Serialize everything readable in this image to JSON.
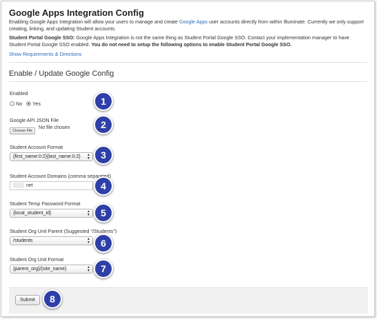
{
  "header": {
    "title": "Google Apps Integration Config",
    "intro_before_link": "Enabling Google Apps Integration will allow your users to manage and create ",
    "intro_link": "Google Apps",
    "intro_after_link": " user accounts directly from within Illuminate. Currently we only support creating, linking, and updating Student accounts.",
    "note_bold_lead": "Student Portal Google SSO:",
    "note_body": " Google Apps Integration is not the same thing as Student Portal Google SSO. Contact your implementation manager to have Student Portal Google SSO enabled. ",
    "note_bold_tail": "You do not need to setup the following options to enable Student Portal Google SSO.",
    "requirements_link": "Show Requirements & Directions"
  },
  "section": {
    "title": "Enable / Update Google Config"
  },
  "form": {
    "enabled": {
      "label": "Enabled",
      "option_no": "No",
      "option_yes": "Yes",
      "selected": "Yes"
    },
    "json_file": {
      "label": "Google API JSON File",
      "button": "Choose File",
      "status": "No file chosen"
    },
    "account_format": {
      "label": "Student Account Format",
      "value": "{first_name:0:2}{last_name:0:2}"
    },
    "account_domains": {
      "label": "Student Account Domains (comma separated)",
      "value": "net"
    },
    "temp_password": {
      "label": "Student Temp Password Format",
      "value": "{local_student_id}"
    },
    "org_unit_parent": {
      "label": "Student Org Unit Parent (Suggested \"/Students\")",
      "value": "/students"
    },
    "org_unit_format": {
      "label": "Student Org Unit Format",
      "value": "{parent_org}/{site_name}"
    },
    "submit": "Submit"
  },
  "badges": [
    "1",
    "2",
    "3",
    "4",
    "5",
    "6",
    "7",
    "8"
  ],
  "colors": {
    "badge": "#2f3fa8",
    "link": "#2a6ebb"
  }
}
